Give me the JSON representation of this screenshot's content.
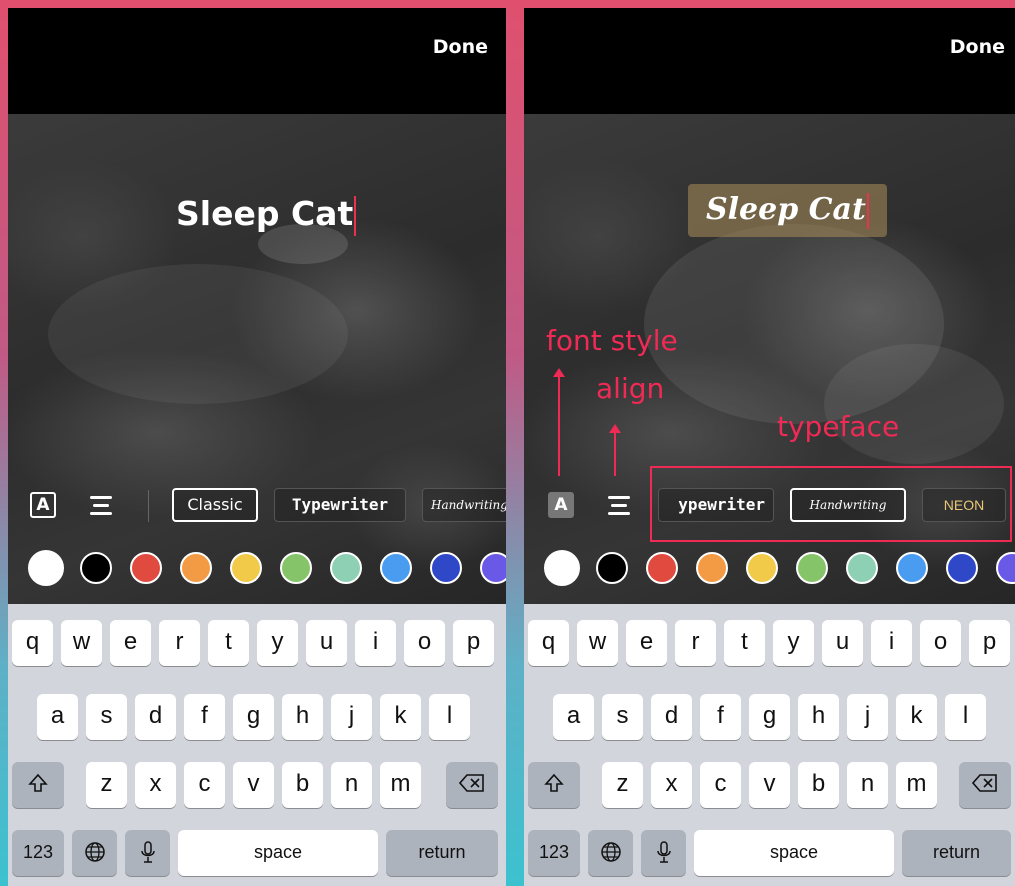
{
  "left": {
    "done_label": "Done",
    "caption_text": "Sleep Cat",
    "icons": {
      "font_style": "A"
    },
    "typefaces": [
      "Classic",
      "Typewriter",
      "Handwriting"
    ]
  },
  "right": {
    "done_label": "Done",
    "caption_text": "Sleep Cat",
    "icons": {
      "font_style": "A"
    },
    "typefaces": [
      "ypewriter",
      "Handwriting",
      "NEON"
    ],
    "annotations": {
      "font_style": "font style",
      "align": "align",
      "typeface": "typeface"
    }
  },
  "colors": [
    "#ffffff",
    "#000000",
    "#e04a3f",
    "#f39a45",
    "#f2ca4a",
    "#86c46a",
    "#8ed0b4",
    "#4a9cf0",
    "#2f48c7",
    "#6a58e6"
  ],
  "keyboard": {
    "row1": [
      "q",
      "w",
      "e",
      "r",
      "t",
      "y",
      "u",
      "i",
      "o",
      "p"
    ],
    "row2": [
      "a",
      "s",
      "d",
      "f",
      "g",
      "h",
      "j",
      "k",
      "l"
    ],
    "row3": [
      "z",
      "x",
      "c",
      "v",
      "b",
      "n",
      "m"
    ],
    "numbers_label": "123",
    "space_label": "space",
    "return_label": "return",
    "shift_icon": "shift-icon",
    "backspace_icon": "backspace-icon",
    "globe_icon": "globe-icon",
    "mic_icon": "microphone-icon"
  },
  "accent_color": "#ef2a55"
}
